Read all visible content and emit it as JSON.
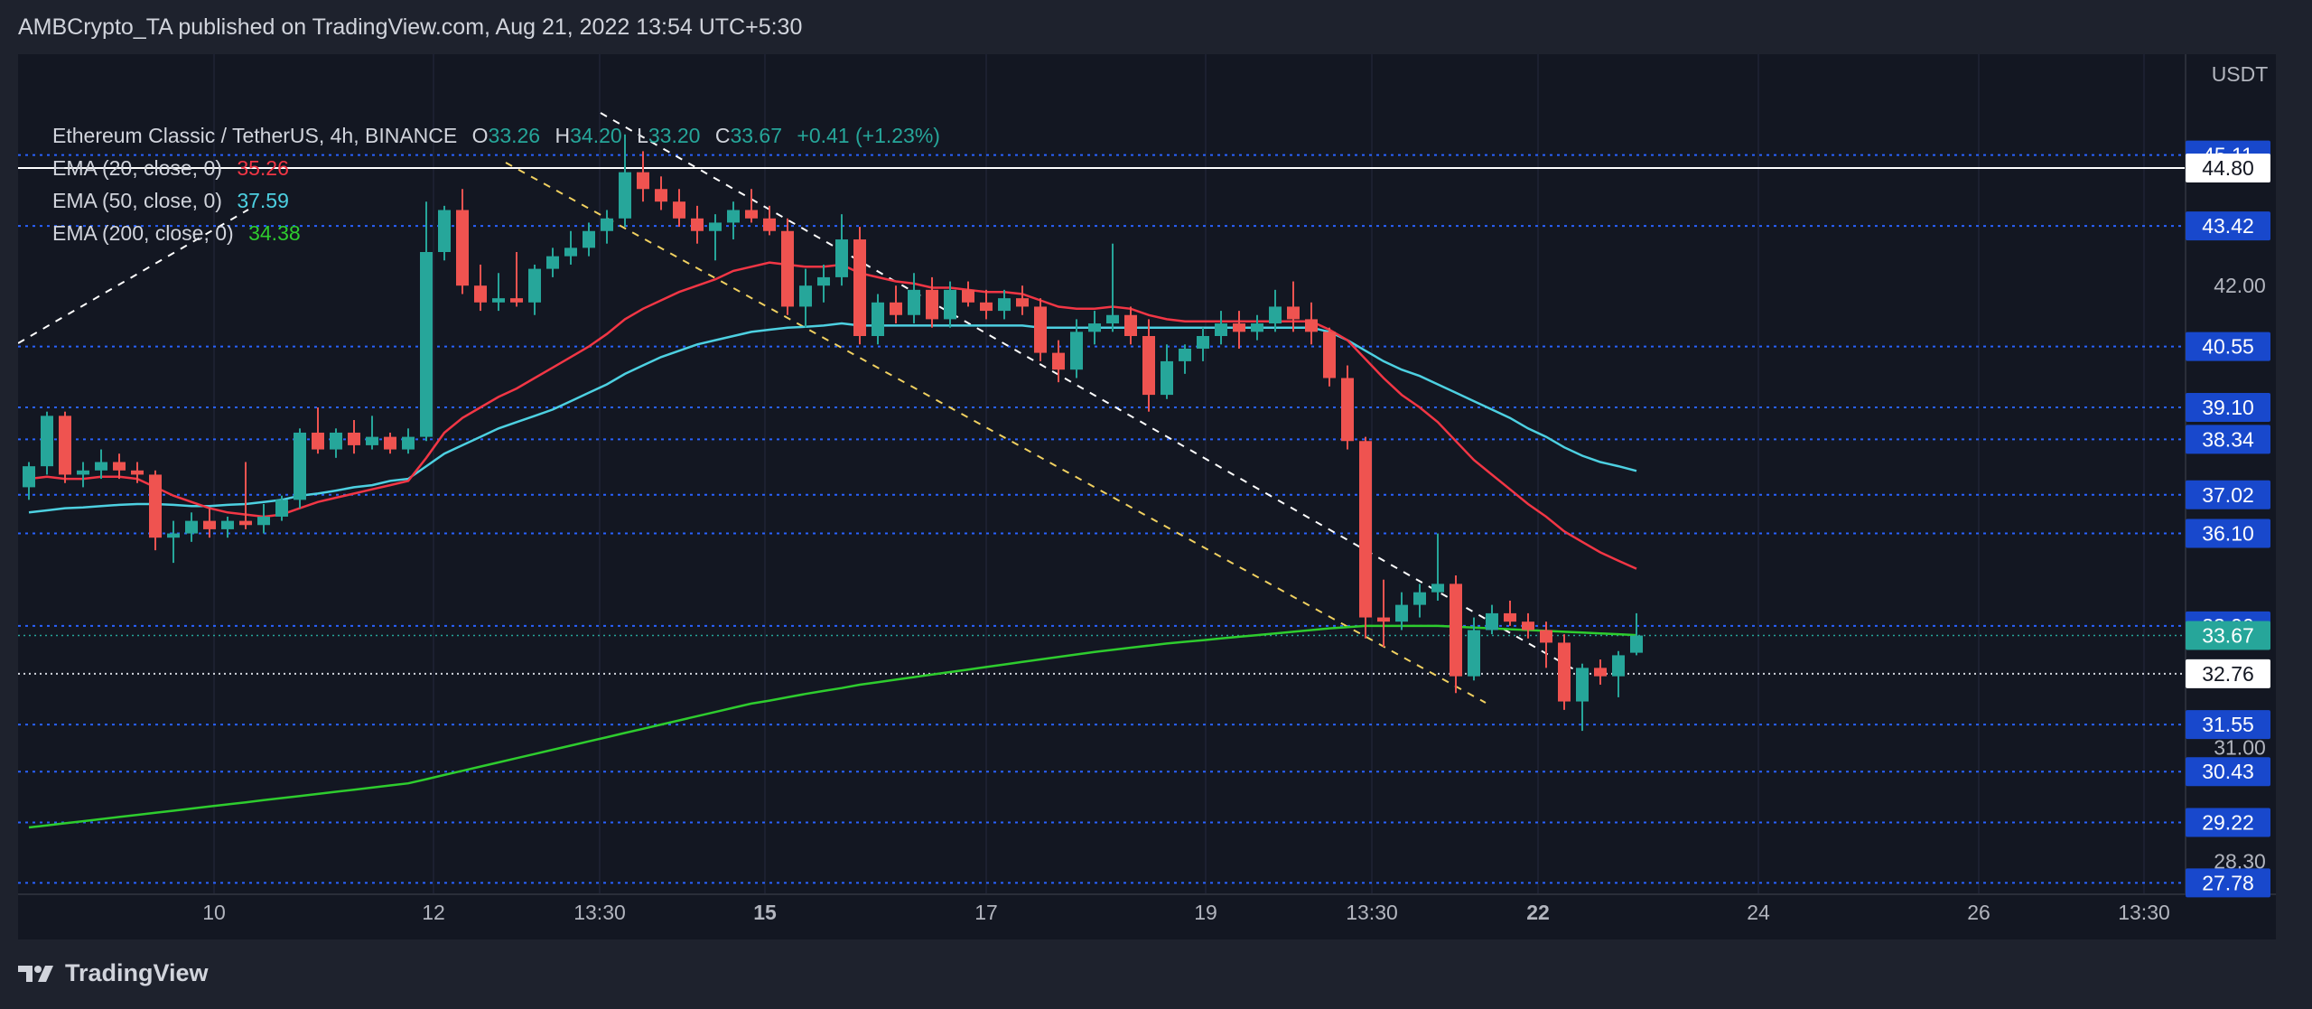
{
  "publisher_line": "AMBCrypto_TA published on TradingView.com, Aug 21, 2022 13:54 UTC+5:30",
  "legend": {
    "symbol": "Ethereum Classic / TetherUS, 4h, BINANCE",
    "o_label": "O",
    "o": "33.26",
    "h_label": "H",
    "h": "34.20",
    "l_label": "L",
    "l": "33.20",
    "c_label": "C",
    "c": "33.67",
    "change": "+0.41 (+1.23%)",
    "ema20_label": "EMA (20, close, 0)",
    "ema20_value": "35.26",
    "ema50_label": "EMA (50, close, 0)",
    "ema50_value": "37.59",
    "ema200_label": "EMA (200, close, 0)",
    "ema200_value": "34.38"
  },
  "footer_brand": "TradingView",
  "colors": {
    "up": "#26a69a",
    "down": "#ef5350",
    "ema20": "#f23645",
    "ema50": "#4dd0e1",
    "ema200": "#2ecc2e",
    "support_line": "#2962ff",
    "price_badge": "#1848cc",
    "last_price_badge": "#26a69a",
    "background": "#131722"
  },
  "chart_data": {
    "type": "candlestick",
    "title": "Ethereum Classic / TetherUS, 4h, BINANCE",
    "currency": "USDT",
    "ylim": [
      26.5,
      47.5
    ],
    "y_ticks": [
      "42.00",
      "31.00",
      "28.30"
    ],
    "x_ticks": [
      "10",
      "12",
      "13:30",
      "15",
      "17",
      "19",
      "13:30",
      "22",
      "24",
      "26",
      "13:30"
    ],
    "horizontal_levels": [
      "45.11",
      "43.42",
      "40.55",
      "39.10",
      "38.34",
      "37.02",
      "36.10",
      "33.90",
      "31.55",
      "30.43",
      "29.22",
      "27.78"
    ],
    "marker_white_line": "44.80",
    "marker_last_price": "33.67",
    "marker_dotted_line": "32.76",
    "grid": true,
    "candles": [
      {
        "o": 37.2,
        "h": 37.8,
        "l": 36.9,
        "c": 37.7
      },
      {
        "o": 37.7,
        "h": 39.0,
        "l": 37.5,
        "c": 38.9
      },
      {
        "o": 38.9,
        "h": 39.0,
        "l": 37.3,
        "c": 37.5
      },
      {
        "o": 37.5,
        "h": 37.8,
        "l": 37.2,
        "c": 37.6
      },
      {
        "o": 37.6,
        "h": 38.1,
        "l": 37.4,
        "c": 37.8
      },
      {
        "o": 37.8,
        "h": 38.0,
        "l": 37.4,
        "c": 37.6
      },
      {
        "o": 37.6,
        "h": 37.8,
        "l": 37.3,
        "c": 37.5
      },
      {
        "o": 37.5,
        "h": 37.6,
        "l": 35.7,
        "c": 36.0
      },
      {
        "o": 36.0,
        "h": 36.4,
        "l": 35.4,
        "c": 36.1
      },
      {
        "o": 36.1,
        "h": 36.6,
        "l": 35.9,
        "c": 36.4
      },
      {
        "o": 36.4,
        "h": 36.7,
        "l": 36.0,
        "c": 36.2
      },
      {
        "o": 36.2,
        "h": 36.5,
        "l": 36.0,
        "c": 36.4
      },
      {
        "o": 36.4,
        "h": 37.8,
        "l": 36.2,
        "c": 36.3
      },
      {
        "o": 36.3,
        "h": 36.8,
        "l": 36.1,
        "c": 36.5
      },
      {
        "o": 36.5,
        "h": 37.0,
        "l": 36.4,
        "c": 36.9
      },
      {
        "o": 36.9,
        "h": 38.6,
        "l": 36.7,
        "c": 38.5
      },
      {
        "o": 38.5,
        "h": 39.1,
        "l": 38.0,
        "c": 38.1
      },
      {
        "o": 38.1,
        "h": 38.6,
        "l": 37.9,
        "c": 38.5
      },
      {
        "o": 38.5,
        "h": 38.8,
        "l": 38.0,
        "c": 38.2
      },
      {
        "o": 38.2,
        "h": 38.9,
        "l": 38.1,
        "c": 38.4
      },
      {
        "o": 38.4,
        "h": 38.5,
        "l": 38.0,
        "c": 38.1
      },
      {
        "o": 38.1,
        "h": 38.6,
        "l": 38.0,
        "c": 38.4
      },
      {
        "o": 38.4,
        "h": 44.0,
        "l": 38.3,
        "c": 42.8
      },
      {
        "o": 42.8,
        "h": 43.9,
        "l": 42.6,
        "c": 43.8
      },
      {
        "o": 43.8,
        "h": 44.3,
        "l": 41.8,
        "c": 42.0
      },
      {
        "o": 42.0,
        "h": 42.5,
        "l": 41.4,
        "c": 41.6
      },
      {
        "o": 41.6,
        "h": 42.3,
        "l": 41.4,
        "c": 41.7
      },
      {
        "o": 41.7,
        "h": 42.8,
        "l": 41.5,
        "c": 41.6
      },
      {
        "o": 41.6,
        "h": 42.5,
        "l": 41.3,
        "c": 42.4
      },
      {
        "o": 42.4,
        "h": 42.9,
        "l": 42.2,
        "c": 42.7
      },
      {
        "o": 42.7,
        "h": 43.3,
        "l": 42.5,
        "c": 42.9
      },
      {
        "o": 42.9,
        "h": 43.5,
        "l": 42.7,
        "c": 43.3
      },
      {
        "o": 43.3,
        "h": 43.8,
        "l": 43.0,
        "c": 43.6
      },
      {
        "o": 43.6,
        "h": 45.6,
        "l": 43.4,
        "c": 44.7
      },
      {
        "o": 44.7,
        "h": 45.2,
        "l": 44.0,
        "c": 44.3
      },
      {
        "o": 44.3,
        "h": 44.6,
        "l": 43.8,
        "c": 44.0
      },
      {
        "o": 44.0,
        "h": 44.3,
        "l": 43.4,
        "c": 43.6
      },
      {
        "o": 43.6,
        "h": 43.9,
        "l": 43.0,
        "c": 43.3
      },
      {
        "o": 43.3,
        "h": 43.7,
        "l": 42.6,
        "c": 43.5
      },
      {
        "o": 43.5,
        "h": 44.0,
        "l": 43.1,
        "c": 43.8
      },
      {
        "o": 43.8,
        "h": 44.3,
        "l": 43.5,
        "c": 43.6
      },
      {
        "o": 43.6,
        "h": 43.9,
        "l": 43.2,
        "c": 43.3
      },
      {
        "o": 43.3,
        "h": 43.6,
        "l": 41.3,
        "c": 41.5
      },
      {
        "o": 41.5,
        "h": 42.4,
        "l": 41.0,
        "c": 42.0
      },
      {
        "o": 42.0,
        "h": 42.5,
        "l": 41.6,
        "c": 42.2
      },
      {
        "o": 42.2,
        "h": 43.7,
        "l": 42.0,
        "c": 43.1
      },
      {
        "o": 43.1,
        "h": 43.4,
        "l": 40.6,
        "c": 40.8
      },
      {
        "o": 40.8,
        "h": 41.8,
        "l": 40.6,
        "c": 41.6
      },
      {
        "o": 41.6,
        "h": 42.0,
        "l": 41.1,
        "c": 41.3
      },
      {
        "o": 41.3,
        "h": 42.3,
        "l": 41.1,
        "c": 41.9
      },
      {
        "o": 41.9,
        "h": 42.2,
        "l": 41.0,
        "c": 41.2
      },
      {
        "o": 41.2,
        "h": 42.1,
        "l": 41.0,
        "c": 41.9
      },
      {
        "o": 41.9,
        "h": 42.1,
        "l": 41.5,
        "c": 41.6
      },
      {
        "o": 41.6,
        "h": 41.9,
        "l": 41.2,
        "c": 41.4
      },
      {
        "o": 41.4,
        "h": 41.9,
        "l": 41.2,
        "c": 41.7
      },
      {
        "o": 41.7,
        "h": 42.0,
        "l": 41.3,
        "c": 41.5
      },
      {
        "o": 41.5,
        "h": 41.7,
        "l": 40.2,
        "c": 40.4
      },
      {
        "o": 40.4,
        "h": 40.7,
        "l": 39.7,
        "c": 40.0
      },
      {
        "o": 40.0,
        "h": 41.2,
        "l": 39.8,
        "c": 40.9
      },
      {
        "o": 40.9,
        "h": 41.4,
        "l": 40.6,
        "c": 41.1
      },
      {
        "o": 41.1,
        "h": 43.0,
        "l": 40.9,
        "c": 41.3
      },
      {
        "o": 41.3,
        "h": 41.5,
        "l": 40.6,
        "c": 40.8
      },
      {
        "o": 40.8,
        "h": 41.2,
        "l": 39.0,
        "c": 39.4
      },
      {
        "o": 39.4,
        "h": 40.6,
        "l": 39.3,
        "c": 40.2
      },
      {
        "o": 40.2,
        "h": 40.6,
        "l": 39.9,
        "c": 40.5
      },
      {
        "o": 40.5,
        "h": 41.0,
        "l": 40.2,
        "c": 40.8
      },
      {
        "o": 40.8,
        "h": 41.4,
        "l": 40.6,
        "c": 41.1
      },
      {
        "o": 41.1,
        "h": 41.4,
        "l": 40.5,
        "c": 40.9
      },
      {
        "o": 40.9,
        "h": 41.3,
        "l": 40.7,
        "c": 41.1
      },
      {
        "o": 41.1,
        "h": 41.9,
        "l": 40.9,
        "c": 41.5
      },
      {
        "o": 41.5,
        "h": 42.1,
        "l": 40.9,
        "c": 41.2
      },
      {
        "o": 41.2,
        "h": 41.6,
        "l": 40.6,
        "c": 40.9
      },
      {
        "o": 40.9,
        "h": 41.0,
        "l": 39.6,
        "c": 39.8
      },
      {
        "o": 39.8,
        "h": 40.1,
        "l": 38.1,
        "c": 38.3
      },
      {
        "o": 38.3,
        "h": 38.4,
        "l": 33.6,
        "c": 34.1
      },
      {
        "o": 34.1,
        "h": 35.0,
        "l": 33.4,
        "c": 34.0
      },
      {
        "o": 34.0,
        "h": 34.7,
        "l": 33.8,
        "c": 34.4
      },
      {
        "o": 34.4,
        "h": 34.9,
        "l": 34.1,
        "c": 34.7
      },
      {
        "o": 34.7,
        "h": 36.1,
        "l": 34.5,
        "c": 34.9
      },
      {
        "o": 34.9,
        "h": 35.1,
        "l": 32.3,
        "c": 32.7
      },
      {
        "o": 32.7,
        "h": 34.1,
        "l": 32.6,
        "c": 33.8
      },
      {
        "o": 33.8,
        "h": 34.4,
        "l": 33.7,
        "c": 34.2
      },
      {
        "o": 34.2,
        "h": 34.5,
        "l": 33.9,
        "c": 34.0
      },
      {
        "o": 34.0,
        "h": 34.2,
        "l": 33.6,
        "c": 33.8
      },
      {
        "o": 33.8,
        "h": 34.0,
        "l": 32.9,
        "c": 33.5
      },
      {
        "o": 33.5,
        "h": 33.7,
        "l": 31.9,
        "c": 32.1
      },
      {
        "o": 32.1,
        "h": 33.0,
        "l": 31.4,
        "c": 32.9
      },
      {
        "o": 32.9,
        "h": 33.1,
        "l": 32.5,
        "c": 32.7
      },
      {
        "o": 32.7,
        "h": 33.3,
        "l": 32.2,
        "c": 33.2
      },
      {
        "o": 33.26,
        "h": 34.2,
        "l": 33.2,
        "c": 33.67
      }
    ],
    "ema20": [
      37.4,
      37.45,
      37.4,
      37.4,
      37.45,
      37.45,
      37.4,
      37.2,
      37.0,
      36.85,
      36.7,
      36.6,
      36.55,
      36.5,
      36.55,
      36.7,
      36.85,
      36.95,
      37.05,
      37.15,
      37.25,
      37.35,
      37.9,
      38.5,
      38.85,
      39.1,
      39.35,
      39.55,
      39.8,
      40.05,
      40.3,
      40.55,
      40.85,
      41.2,
      41.45,
      41.65,
      41.85,
      42.0,
      42.15,
      42.35,
      42.45,
      42.55,
      42.5,
      42.45,
      42.45,
      42.5,
      42.3,
      42.2,
      42.1,
      42.05,
      41.95,
      41.95,
      41.9,
      41.85,
      41.85,
      41.8,
      41.65,
      41.5,
      41.45,
      41.45,
      41.5,
      41.45,
      41.3,
      41.2,
      41.15,
      41.15,
      41.15,
      41.15,
      41.15,
      41.15,
      41.15,
      41.15,
      40.95,
      40.7,
      40.25,
      39.8,
      39.4,
      39.1,
      38.75,
      38.3,
      37.85,
      37.5,
      37.15,
      36.8,
      36.5,
      36.15,
      35.9,
      35.65,
      35.45,
      35.26
    ],
    "ema50": [
      36.6,
      36.65,
      36.7,
      36.72,
      36.75,
      36.78,
      36.8,
      36.8,
      36.78,
      36.75,
      36.75,
      36.78,
      36.8,
      36.85,
      36.9,
      37.0,
      37.05,
      37.12,
      37.2,
      37.25,
      37.35,
      37.4,
      37.7,
      38.0,
      38.2,
      38.4,
      38.6,
      38.75,
      38.9,
      39.05,
      39.25,
      39.45,
      39.65,
      39.9,
      40.1,
      40.3,
      40.45,
      40.6,
      40.7,
      40.8,
      40.9,
      40.95,
      41.0,
      41.02,
      41.05,
      41.1,
      41.05,
      41.05,
      41.05,
      41.05,
      41.05,
      41.05,
      41.05,
      41.05,
      41.05,
      41.05,
      41.0,
      41.0,
      41.0,
      41.0,
      41.0,
      41.0,
      41.0,
      41.0,
      41.0,
      41.0,
      41.0,
      41.0,
      41.0,
      41.0,
      41.0,
      41.0,
      40.9,
      40.7,
      40.45,
      40.2,
      40.0,
      39.85,
      39.65,
      39.45,
      39.25,
      39.05,
      38.85,
      38.6,
      38.4,
      38.15,
      37.95,
      37.8,
      37.7,
      37.59
    ],
    "ema200": [
      29.1,
      29.15,
      29.2,
      29.25,
      29.3,
      29.35,
      29.4,
      29.45,
      29.5,
      29.55,
      29.6,
      29.65,
      29.7,
      29.75,
      29.8,
      29.85,
      29.9,
      29.95,
      30.0,
      30.05,
      30.1,
      30.15,
      30.25,
      30.35,
      30.45,
      30.55,
      30.65,
      30.75,
      30.85,
      30.95,
      31.05,
      31.15,
      31.25,
      31.35,
      31.45,
      31.55,
      31.65,
      31.75,
      31.85,
      31.95,
      32.05,
      32.12,
      32.2,
      32.28,
      32.35,
      32.42,
      32.5,
      32.56,
      32.62,
      32.68,
      32.74,
      32.8,
      32.86,
      32.92,
      32.98,
      33.04,
      33.1,
      33.16,
      33.22,
      33.28,
      33.33,
      33.38,
      33.43,
      33.48,
      33.52,
      33.56,
      33.6,
      33.64,
      33.68,
      33.72,
      33.76,
      33.8,
      33.84,
      33.87,
      33.9,
      33.9,
      33.9,
      33.9,
      33.9,
      33.88,
      33.86,
      33.84,
      33.82,
      33.8,
      33.78,
      33.76,
      33.74,
      33.72,
      33.7,
      33.68
    ]
  }
}
